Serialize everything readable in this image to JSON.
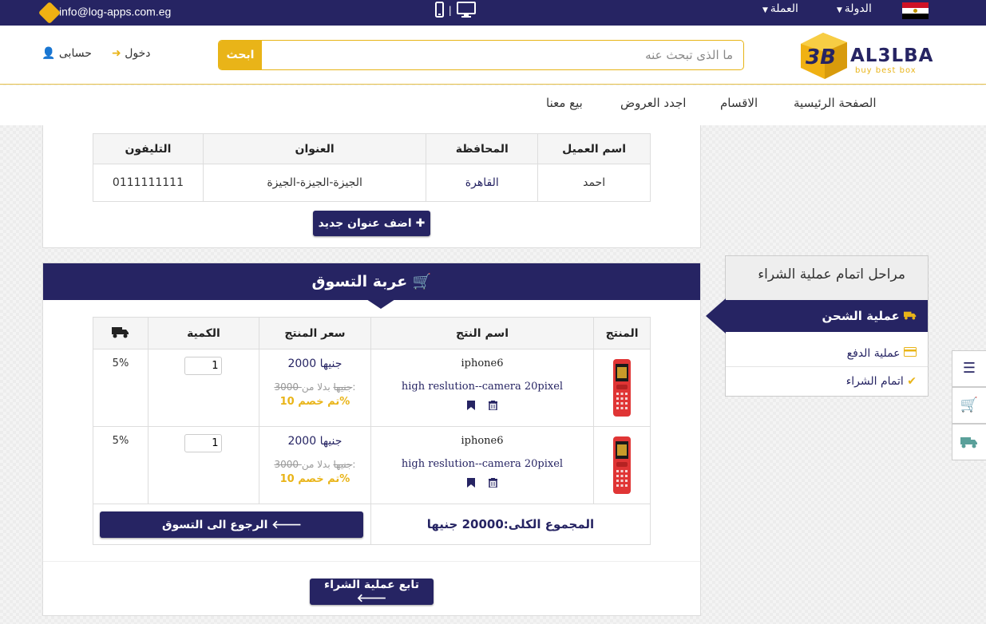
{
  "topbar": {
    "email": "info@log-apps.com.eg",
    "country_label": "الدولة",
    "currency_label": "العملة",
    "separator": "|"
  },
  "header": {
    "search_button": "ابحث",
    "search_placeholder": "ما الذى تبحث عنه",
    "login": "دخول",
    "account": "حسابى",
    "logo_text": "AL3LBA",
    "logo_tagline": "buy best box",
    "logo_mark": "3B"
  },
  "nav": {
    "items": [
      "الصفحة الرئيسية",
      "الاقسام",
      "اجدد العروض",
      "بيع معنا"
    ]
  },
  "address": {
    "headers": [
      "اسم العميل",
      "المحافظة",
      "العنوان",
      "التليفون"
    ],
    "row": {
      "name": "احمد",
      "governorate": "القاهرة",
      "address": "الجيزة-الجيزة-الجيزة",
      "phone": "0111111111"
    },
    "add_button": "اضف عنوان جديد"
  },
  "cart": {
    "title": "عربة التسوق",
    "headers": {
      "product": "المنتج",
      "name": "اسم النتج",
      "price": "سعر المنتج",
      "quantity": "الكمية"
    },
    "items": [
      {
        "name": "iphone6",
        "desc": "high reslution--camera 20pixel",
        "price": "2000 جنيها",
        "old_price": "3000 جنيها",
        "old_prefix": "بدلا من:",
        "discount": "تم خصم 10%",
        "qty": "1",
        "ship": "5%"
      },
      {
        "name": "iphone6",
        "desc": "high reslution--camera 20pixel",
        "price": "2000 جنيها",
        "old_price": "3000 جنيها",
        "old_prefix": "بدلا من:",
        "discount": "تم خصم 10%",
        "qty": "1",
        "ship": "5%"
      }
    ],
    "total": "المجموع الكلى:20000 جنيها",
    "back_button": "الرجوع الى التسوق",
    "continue_button": "تابع عملية الشراء"
  },
  "steps": {
    "title": "مراحل اتمام عملية الشراء",
    "active": "عملية الشحن",
    "items": [
      "عملية الدفع",
      "اتمام الشراء"
    ]
  },
  "colors": {
    "navy": "#262463",
    "accent": "#e9b418"
  },
  "icons": [
    "email-tag-icon",
    "mobile-icon",
    "desktop-icon",
    "caret-down-icon",
    "egypt-flag-icon",
    "sign-in-icon",
    "user-icon",
    "plus-icon",
    "cart-icon",
    "truck-icon",
    "bookmark-icon",
    "trash-icon",
    "arrow-left-icon",
    "credit-card-icon",
    "check-icon",
    "list-icon"
  ]
}
